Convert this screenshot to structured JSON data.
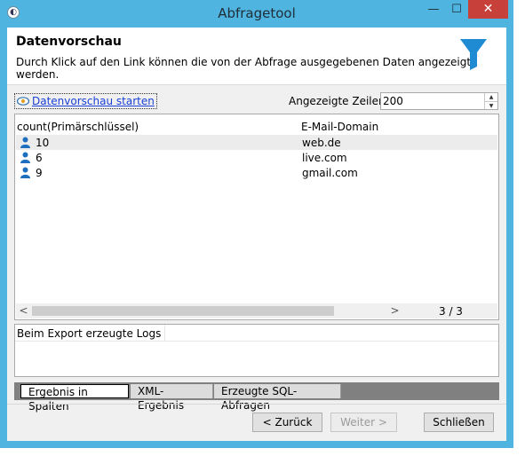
{
  "window": {
    "title": "Abfragetool",
    "app_icon_glyph": "◐",
    "min_glyph": "—",
    "max_glyph": "☐",
    "close_glyph": "✕"
  },
  "header": {
    "title": "Datenvorschau",
    "subtitle": "Durch Klick auf den Link können die von der Abfrage ausgegebenen Daten angezeigt werden.",
    "icon": "filter-icon",
    "accent_color": "#1e8bd2"
  },
  "toolbar": {
    "preview_link": "Datenvorschau starten",
    "rows_label": "Angezeigte Zeilen:",
    "rows_value": "200"
  },
  "grid": {
    "columns": [
      "count(Primärschlüssel)",
      "E-Mail-Domain"
    ],
    "rows": [
      {
        "count": "10",
        "domain": "web.de"
      },
      {
        "count": "6",
        "domain": "live.com"
      },
      {
        "count": "9",
        "domain": "gmail.com"
      }
    ],
    "row_count": "3 / 3",
    "scroll_left": "<",
    "scroll_right": ">"
  },
  "logs": {
    "header": "Beim Export erzeugte Logs"
  },
  "tabs": [
    {
      "label": "Ergebnis in Spalten",
      "active": true
    },
    {
      "label": "XML-Ergebnis",
      "active": false
    },
    {
      "label": "Erzeugte SQL-Abfragen",
      "active": false
    }
  ],
  "buttons": {
    "back": "< Zurück",
    "next": "Weiter >",
    "close": "Schließen"
  },
  "colors": {
    "titlebar": "#4fb4e0",
    "close_button": "#c7403a",
    "link": "#1a3fd6"
  }
}
